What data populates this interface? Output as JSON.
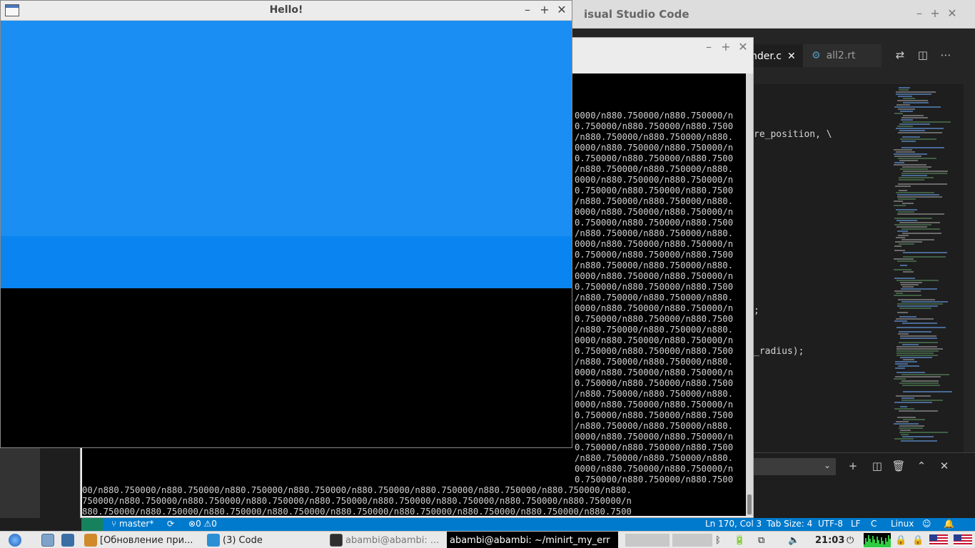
{
  "vscode": {
    "title": "isual Studio Code",
    "tabs": [
      {
        "label": "nder.c",
        "close": "✕"
      },
      {
        "label": "all2.rt",
        "icon": "gear-icon"
      }
    ],
    "code": {
      "frag1": "re_position, \\",
      "frag2": ";",
      "frag3": "_radius);"
    },
    "panel": {
      "select_value": ""
    },
    "statusbar": {
      "branch": "master*",
      "errors": "0",
      "warnings": "0",
      "position": "Ln 170, Col 3",
      "tab_size": "Tab Size: 4",
      "encoding": "UTF-8",
      "eol": "LF",
      "language": "C",
      "platform": "Linux"
    }
  },
  "terminal": {
    "lines_left": [
      "0000/n880.750000/n880.750000/n",
      "0.750000/n880.750000/n880.7500",
      "/n880.750000/n880.750000/n880.",
      "0000/n880.750000/n880.750000/n",
      "0.750000/n880.750000/n880.7500",
      "/n880.750000/n880.750000/n880.",
      "0000/n880.750000/n880.750000/n",
      "0.750000/n880.750000/n880.7500",
      "/n880.750000/n880.750000/n880.",
      "0000/n880.750000/n880.750000/n",
      "0.750000/n880.750000/n880.7500",
      "/n880.750000/n880.750000/n880.",
      "0000/n880.750000/n880.750000/n",
      "0.750000/n880.750000/n880.7500",
      "/n880.750000/n880.750000/n880.",
      "0000/n880.750000/n880.750000/n",
      "0.750000/n880.750000/n880.7500",
      "/n880.750000/n880.750000/n880.",
      "0000/n880.750000/n880.750000/n",
      "0.750000/n880.750000/n880.7500",
      "/n880.750000/n880.750000/n880.",
      "0000/n880.750000/n880.750000/n",
      "0.750000/n880.750000/n880.7500",
      "/n880.750000/n880.750000/n880.",
      "0000/n880.750000/n880.750000/n",
      "0.750000/n880.750000/n880.7500",
      "/n880.750000/n880.750000/n880.",
      "0000/n880.750000/n880.750000/n",
      "0.750000/n880.750000/n880.7500",
      "/n880.750000/n880.750000/n880.",
      "0000/n880.750000/n880.750000/n",
      "0.750000/n880.750000/n880.7500",
      "/n880.750000/n880.750000/n880.",
      "0000/n880.750000/n880.750000/n",
      "0.750000/n880.750000/n880.7500"
    ],
    "lines_full": [
      "00/n880.750000/n880.750000/n880.750000/n880.750000/n880.750000/n880.750000/n880.750000/n880.750000/n880.",
      "750000/n880.750000/n880.750000/n880.750000/n880.750000/n880.750000/n880.750000/n880.750000/n880.750000/n",
      "880.750000/n880.750000/n880.750000/n880.750000/n880.750000/n880.750000/n880.750000/n880.750000/n880.7500",
      "00/n880.750000/n880.750000/n880.750000/n880.750000/n880.750000/n880.750000/n880.750000/n880.750000/n880.",
      "750000/n880.750000/n880.750000/n880.750000/n880.750000/n880.750000/n880.750000/n880.750000/n880.750000/n"
    ],
    "last_line": "880.750000/n880.750000/n880.750000/n880.750000/n880.750000/n880.750000/n880."
  },
  "hello": {
    "title": "Hello!"
  },
  "colors": {
    "sky_top": "#1a8ef2",
    "sky_bottom": "#0a84f0",
    "statusbar": "#007acc",
    "taskbar_active": "#000000"
  },
  "taskbar": {
    "items": [
      {
        "label": "[Обновление при...",
        "icon": "package-icon"
      },
      {
        "label": "(3) Code",
        "icon": "vscode-icon"
      },
      {
        "label": "abambi@abambi: ...",
        "icon": "terminal-icon"
      },
      {
        "label": "abambi@abambi: ~/minirt_my_err",
        "icon": ""
      }
    ],
    "clock": "21:03",
    "volume_icon": "speaker-icon",
    "power_icon": "power-icon",
    "keyboard_layout": "us-flag-icon"
  }
}
